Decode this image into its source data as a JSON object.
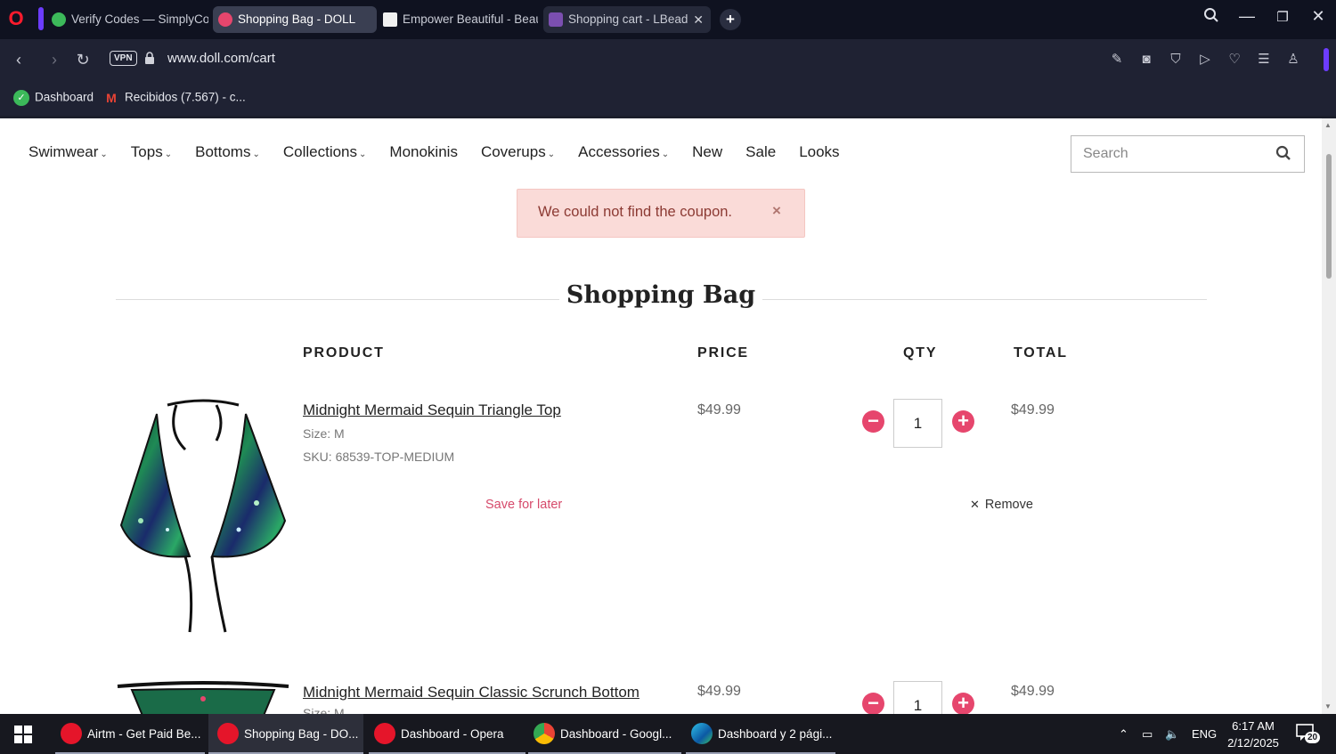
{
  "browser": {
    "tabs": [
      {
        "title": "Verify Codes — SimplyCodes",
        "favicon_color": "#3cb95a",
        "active": false
      },
      {
        "title": "Shopping Bag - DOLL",
        "favicon_color": "#e6466d",
        "active": true
      },
      {
        "title": "Empower Beautiful - Beauty",
        "favicon_color": "#f0f0f0",
        "active": false
      },
      {
        "title": "Shopping cart - LBead",
        "favicon_color": "#7b4fb0",
        "active": false
      }
    ],
    "url": "www.doll.com/cart",
    "vpn_label": "VPN",
    "bookmarks": [
      {
        "label": "Dashboard",
        "icon": "dashboard-icon"
      },
      {
        "label": "Recibidos (7.567) - c...",
        "icon": "gmail-icon"
      }
    ]
  },
  "site": {
    "nav": [
      {
        "label": "Swimwear",
        "dropdown": true
      },
      {
        "label": "Tops",
        "dropdown": true
      },
      {
        "label": "Bottoms",
        "dropdown": true
      },
      {
        "label": "Collections",
        "dropdown": true
      },
      {
        "label": "Monokinis",
        "dropdown": false
      },
      {
        "label": "Coverups",
        "dropdown": true
      },
      {
        "label": "Accessories",
        "dropdown": true
      },
      {
        "label": "New",
        "dropdown": false
      },
      {
        "label": "Sale",
        "dropdown": false
      },
      {
        "label": "Looks",
        "dropdown": false
      }
    ],
    "search_placeholder": "Search",
    "alert": {
      "message": "We could not find the coupon.",
      "close": "×"
    },
    "page_title": "Shopping Bag",
    "columns": {
      "product": "PRODUCT",
      "price": "PRICE",
      "qty": "QTY",
      "total": "TOTAL"
    },
    "cart": [
      {
        "name": "Midnight Mermaid Sequin Triangle Top",
        "size": "Size: M",
        "sku": "SKU: 68539-TOP-MEDIUM",
        "price": "$49.99",
        "qty": "1",
        "total": "$49.99",
        "save_for_later": "Save for later",
        "remove": "Remove"
      },
      {
        "name": "Midnight Mermaid Sequin Classic Scrunch Bottom",
        "size": "Size: M",
        "price": "$49.99",
        "qty": "1",
        "total": "$49.99"
      }
    ],
    "accent_color": "#e6466d"
  },
  "taskbar": {
    "items": [
      {
        "label": "Airtm - Get Paid Be...",
        "app": "opera",
        "active": false
      },
      {
        "label": "Shopping Bag - DO...",
        "app": "opera",
        "active": true
      },
      {
        "label": "Dashboard - Opera",
        "app": "opera",
        "active": false
      },
      {
        "label": "Dashboard - Googl...",
        "app": "chrome",
        "active": false
      },
      {
        "label": "Dashboard y 2 pági...",
        "app": "edge",
        "active": false
      }
    ],
    "lang": "ENG",
    "time": "6:17 AM",
    "date": "2/12/2025",
    "notifications": "20"
  }
}
